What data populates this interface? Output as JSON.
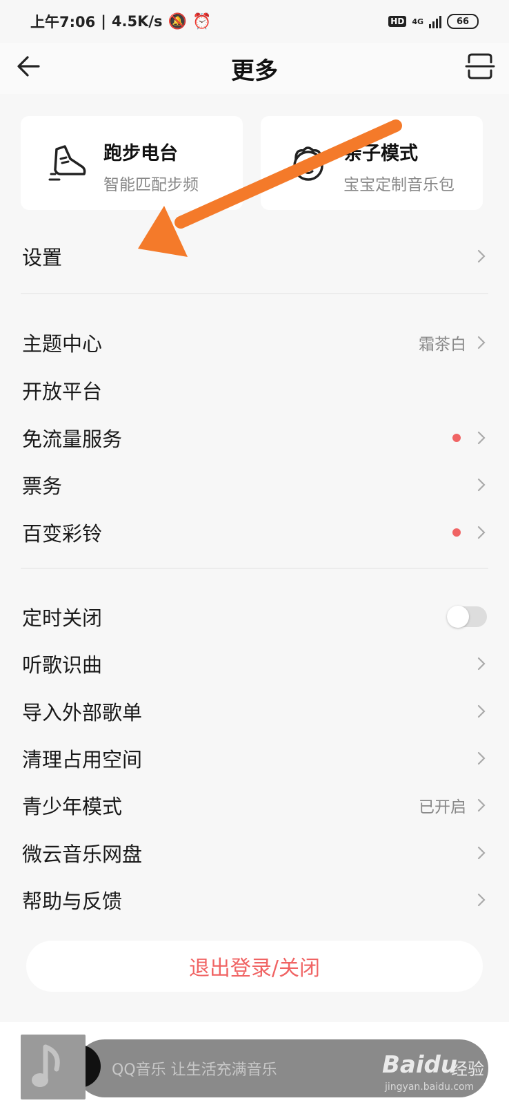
{
  "status_bar": {
    "time": "上午7:06",
    "speed": "4.5K/s",
    "hd": "HD",
    "network": "4G",
    "battery": "66"
  },
  "header": {
    "title": "更多"
  },
  "cards": [
    {
      "title": "跑步电台",
      "subtitle": "智能匹配步频",
      "icon": "running-shoe-icon"
    },
    {
      "title": "亲子模式",
      "subtitle": "宝宝定制音乐包",
      "icon": "child-face-icon"
    }
  ],
  "menu": {
    "settings": {
      "label": "设置"
    },
    "group1": [
      {
        "label": "主题中心",
        "value": "霜茶白",
        "chevron": true
      },
      {
        "label": "开放平台"
      },
      {
        "label": "免流量服务",
        "dot": true,
        "chevron": true
      },
      {
        "label": "票务",
        "chevron": true
      },
      {
        "label": "百变彩铃",
        "dot": true,
        "chevron": true
      }
    ],
    "group2": [
      {
        "label": "定时关闭",
        "toggle": false
      },
      {
        "label": "听歌识曲",
        "chevron": true
      },
      {
        "label": "导入外部歌单",
        "chevron": true
      },
      {
        "label": "清理占用空间",
        "chevron": true
      },
      {
        "label": "青少年模式",
        "value": "已开启",
        "chevron": true
      },
      {
        "label": "微云音乐网盘",
        "chevron": true
      },
      {
        "label": "帮助与反馈",
        "chevron": true
      }
    ]
  },
  "logout": {
    "label": "退出登录/关闭"
  },
  "player": {
    "text": "QQ音乐 让生活充满音乐"
  },
  "watermark": {
    "brand": "Baidu",
    "cn": "经验",
    "url": "jingyan.baidu.com"
  },
  "colors": {
    "accent_red": "#f06464",
    "arrow_orange": "#f47a2a"
  }
}
